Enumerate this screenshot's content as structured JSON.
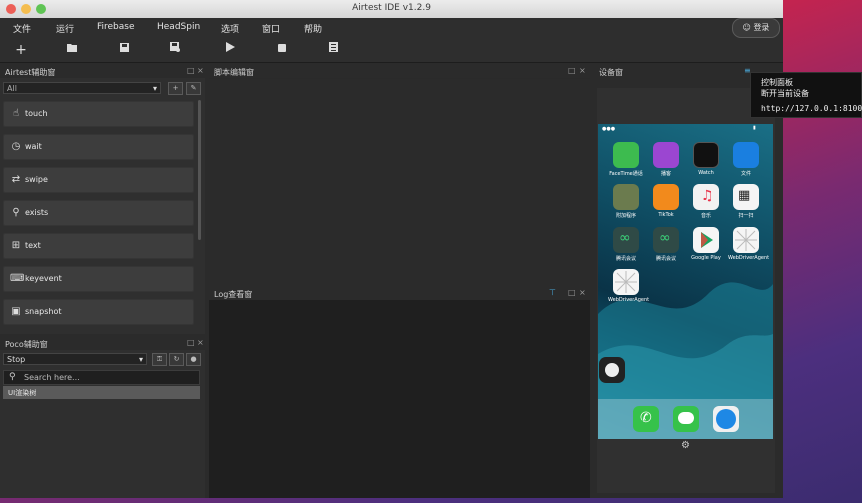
{
  "window": {
    "title": "Airtest IDE v1.2.9"
  },
  "menubar": {
    "items": [
      "文件",
      "运行",
      "Firebase",
      "HeadSpin",
      "选项",
      "窗口",
      "帮助"
    ],
    "login_label": "登录"
  },
  "toolbar": {
    "buttons": [
      "new-file-icon",
      "open-folder-icon",
      "save-icon",
      "save-as-icon",
      "run-icon",
      "stop-icon",
      "log-icon"
    ]
  },
  "airtest_panel": {
    "title": "Airtest辅助窗",
    "filter_value": "All",
    "commands": [
      "touch",
      "wait",
      "swipe",
      "exists",
      "text",
      "keyevent",
      "snapshot"
    ]
  },
  "poco_panel": {
    "title": "Poco辅助窗",
    "mode_value": "Stop",
    "search_placeholder": "Search here...",
    "tree_root": "UI渲染树"
  },
  "script_panel": {
    "title": "脚本编辑窗"
  },
  "log_panel": {
    "title": "Log查看窗"
  },
  "device_panel": {
    "title": "设备窗"
  },
  "context_menu": {
    "items": [
      "控制面板",
      "断开当前设备"
    ],
    "address": "http://127.0.0.1:8100"
  },
  "phone": {
    "apps": [
      {
        "label": "FaceTime通话",
        "color": "#3dbb4f"
      },
      {
        "label": "播客",
        "color": "#9b46d1"
      },
      {
        "label": "Watch",
        "color": "#111111"
      },
      {
        "label": "文件",
        "color": "#1a7fe0"
      },
      {
        "label": "附加程序",
        "color": "#6b7b4e"
      },
      {
        "label": "TikTok",
        "color": "#f28a1c"
      },
      {
        "label": "音乐",
        "color": "#f2f2f2"
      },
      {
        "label": "扫一扫",
        "color": "#f5f5f5"
      },
      {
        "label": "腾讯会议",
        "color": "#2f4a46"
      },
      {
        "label": "腾讯会议",
        "color": "#2f4a46"
      },
      {
        "label": "Google Play",
        "color": "#f5f5f5"
      },
      {
        "label": "WebDriverAgent",
        "color": "#f5f5f5"
      },
      {
        "label": "WebDriverAgent",
        "color": "#f5f5f5"
      }
    ],
    "dock": [
      {
        "name": "phone-app-icon",
        "color": "#36c24a"
      },
      {
        "name": "messages-app-icon",
        "color": "#36c24a"
      },
      {
        "name": "safari-app-icon",
        "color": "#f0f0f0"
      }
    ]
  }
}
